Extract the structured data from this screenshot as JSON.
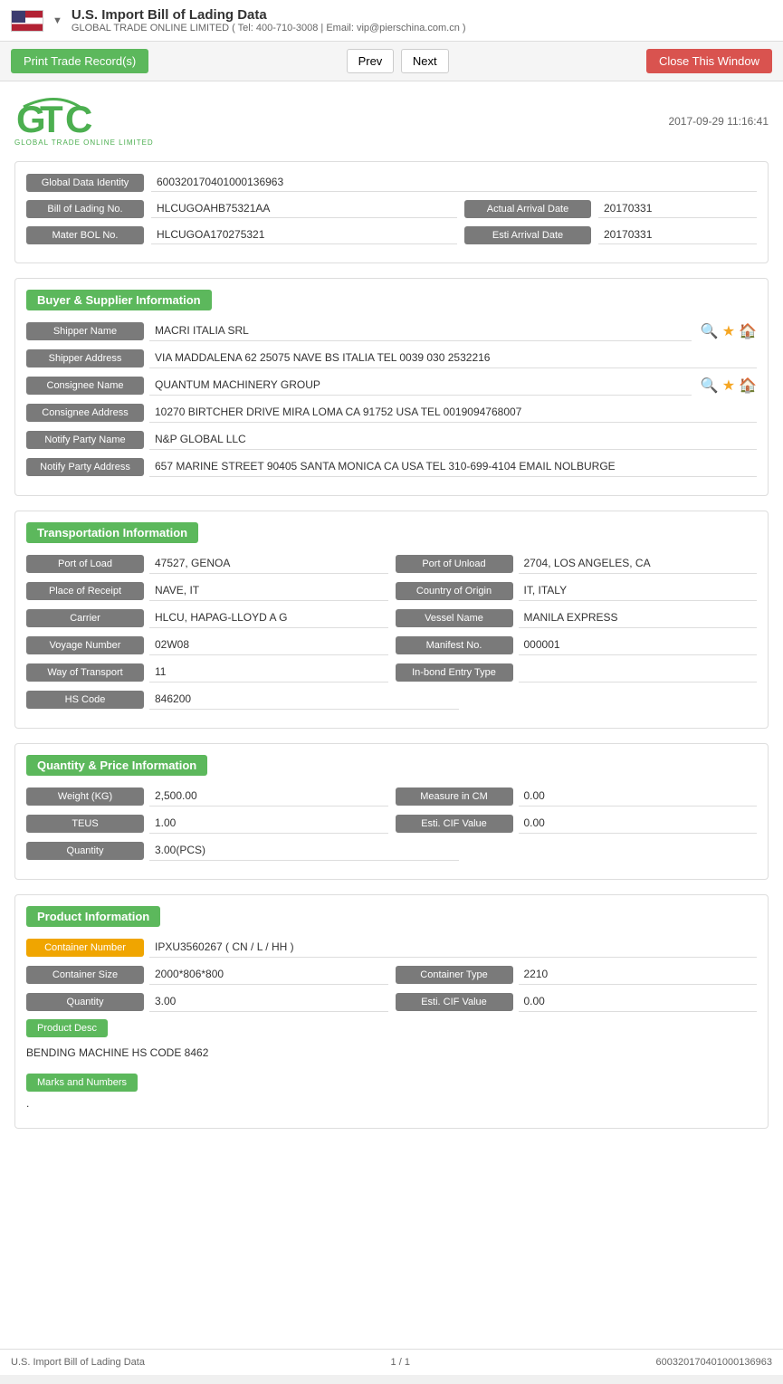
{
  "header": {
    "title": "U.S. Import Bill of Lading Data",
    "subtitle": "GLOBAL TRADE ONLINE LIMITED ( Tel: 400-710-3008 | Email: vip@pierschina.com.cn )",
    "dropdown_arrow": "▼"
  },
  "toolbar": {
    "print_label": "Print Trade Record(s)",
    "prev_label": "Prev",
    "next_label": "Next",
    "close_label": "Close This Window"
  },
  "logo": {
    "text": "GTO",
    "subtitle": "GLOBAL TRADE ONLINE LIMITED",
    "timestamp": "2017-09-29 11:16:41"
  },
  "identity": {
    "global_data_label": "Global Data Identity",
    "global_data_value": "600320170401000136963",
    "bol_label": "Bill of Lading No.",
    "bol_value": "HLCUGOAHB75321AA",
    "actual_arrival_label": "Actual Arrival Date",
    "actual_arrival_value": "20170331",
    "master_bol_label": "Mater BOL No.",
    "master_bol_value": "HLCUGOA170275321",
    "esti_arrival_label": "Esti Arrival Date",
    "esti_arrival_value": "20170331"
  },
  "buyer_supplier": {
    "section_title": "Buyer & Supplier Information",
    "shipper_name_label": "Shipper Name",
    "shipper_name_value": "MACRI ITALIA SRL",
    "shipper_address_label": "Shipper Address",
    "shipper_address_value": "VIA MADDALENA 62 25075 NAVE BS ITALIA TEL 0039 030 2532216",
    "consignee_name_label": "Consignee Name",
    "consignee_name_value": "QUANTUM MACHINERY GROUP",
    "consignee_address_label": "Consignee Address",
    "consignee_address_value": "10270 BIRTCHER DRIVE MIRA LOMA CA 91752 USA TEL 0019094768007",
    "notify_party_label": "Notify Party Name",
    "notify_party_value": "N&P GLOBAL LLC",
    "notify_party_address_label": "Notify Party Address",
    "notify_party_address_value": "657 MARINE STREET 90405 SANTA MONICA CA USA TEL 310-699-4104 EMAIL NOLBURGE"
  },
  "transportation": {
    "section_title": "Transportation Information",
    "port_of_load_label": "Port of Load",
    "port_of_load_value": "47527, GENOA",
    "port_of_unload_label": "Port of Unload",
    "port_of_unload_value": "2704, LOS ANGELES, CA",
    "place_of_receipt_label": "Place of Receipt",
    "place_of_receipt_value": "NAVE, IT",
    "country_of_origin_label": "Country of Origin",
    "country_of_origin_value": "IT, ITALY",
    "carrier_label": "Carrier",
    "carrier_value": "HLCU, HAPAG-LLOYD A G",
    "vessel_name_label": "Vessel Name",
    "vessel_name_value": "MANILA EXPRESS",
    "voyage_number_label": "Voyage Number",
    "voyage_number_value": "02W08",
    "manifest_no_label": "Manifest No.",
    "manifest_no_value": "000001",
    "way_of_transport_label": "Way of Transport",
    "way_of_transport_value": "11",
    "in_bond_entry_label": "In-bond Entry Type",
    "in_bond_entry_value": "",
    "hs_code_label": "HS Code",
    "hs_code_value": "846200"
  },
  "quantity_price": {
    "section_title": "Quantity & Price Information",
    "weight_label": "Weight (KG)",
    "weight_value": "2,500.00",
    "measure_label": "Measure in CM",
    "measure_value": "0.00",
    "teus_label": "TEUS",
    "teus_value": "1.00",
    "esti_cif_label": "Esti. CIF Value",
    "esti_cif_value": "0.00",
    "quantity_label": "Quantity",
    "quantity_value": "3.00(PCS)"
  },
  "product": {
    "section_title": "Product Information",
    "container_number_label": "Container Number",
    "container_number_value": "IPXU3560267 ( CN / L / HH )",
    "container_size_label": "Container Size",
    "container_size_value": "2000*806*800",
    "container_type_label": "Container Type",
    "container_type_value": "2210",
    "quantity_label": "Quantity",
    "quantity_value": "3.00",
    "esti_cif_label": "Esti. CIF Value",
    "esti_cif_value": "0.00",
    "product_desc_btn": "Product Desc",
    "product_desc_text": "BENDING MACHINE HS CODE 8462",
    "marks_btn": "Marks and Numbers",
    "marks_value": "."
  },
  "footer": {
    "left": "U.S. Import Bill of Lading Data",
    "center": "1 / 1",
    "right": "600320170401000136963"
  }
}
